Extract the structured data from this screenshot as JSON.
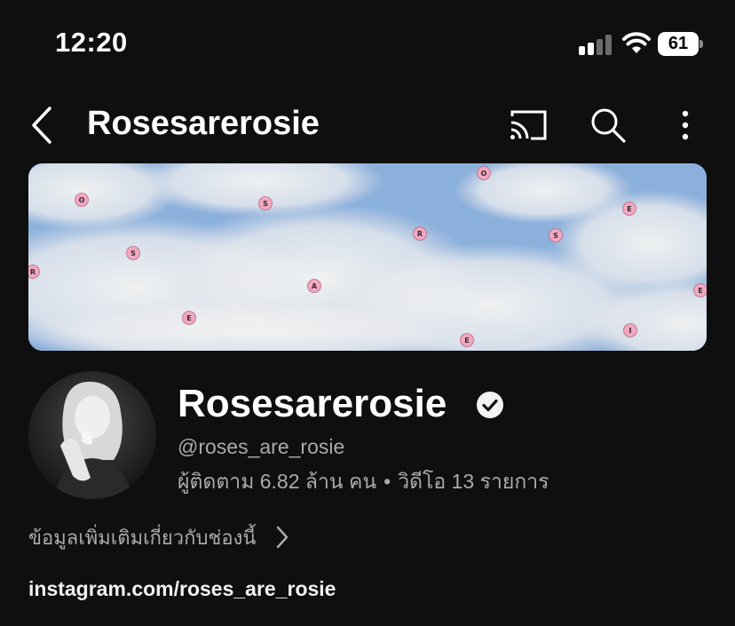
{
  "status_bar": {
    "time": "12:20",
    "battery_level": "61",
    "signal_bars_filled": 2,
    "signal_bars_total": 4
  },
  "header": {
    "title": "Rosesarerosie",
    "icons": [
      "back-icon",
      "cast-icon",
      "search-icon",
      "more-vertical-icon"
    ]
  },
  "banner": {
    "letters": [
      "O",
      "S",
      "R",
      "S",
      "A",
      "E",
      "R",
      "O",
      "S",
      "E",
      "E",
      "I",
      "E"
    ]
  },
  "channel": {
    "name": "Rosesarerosie",
    "verified": true,
    "handle": "@roses_are_rosie",
    "subscribers": "ผู้ติดตาม 6.82 ล้าน คน",
    "separator": "•",
    "videos": "วิดีโอ 13 รายการ",
    "about_label": "ข้อมูลเพิ่มเติมเกี่ยวกับช่องนี้",
    "link": "instagram.com/roses_are_rosie"
  },
  "colors": {
    "background": "#0f0f0f",
    "primary_text": "#f1f1f1",
    "secondary_text": "#aaaaaa",
    "banner_letter_dot": "#f0a8c0"
  }
}
